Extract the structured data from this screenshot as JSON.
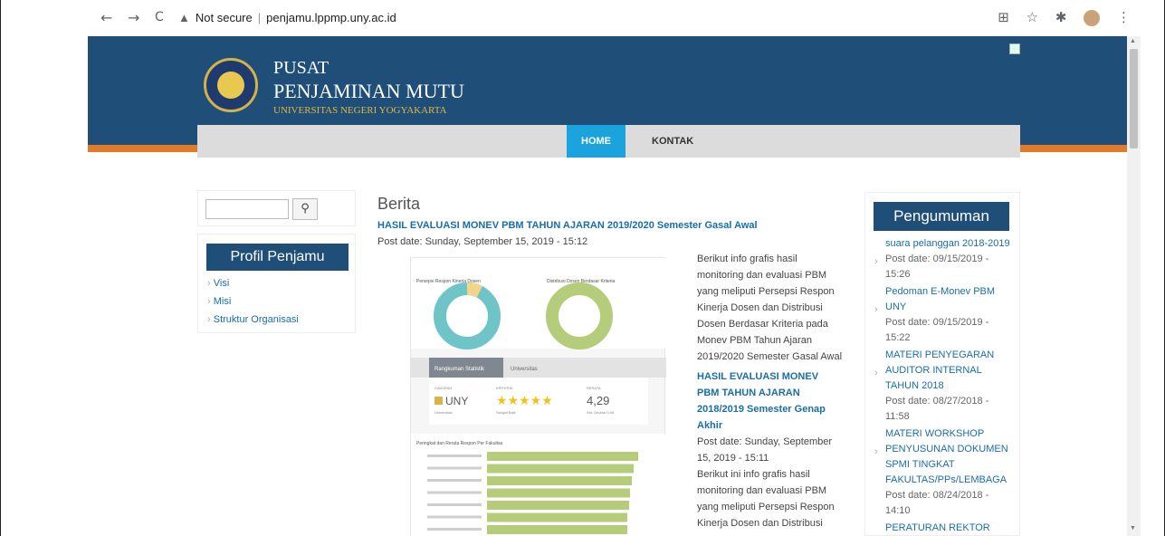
{
  "browser": {
    "back": "←",
    "forward": "→",
    "reload": "C",
    "security_label": "Not secure",
    "url": "penjamu.lppmp.uny.ac.id"
  },
  "site": {
    "title_line1": "PUSAT",
    "title_line2": "PENJAMINAN MUTU",
    "subtitle": "UNIVERSITAS NEGERI YOGYAKARTA",
    "menu": [
      {
        "label": "HOME"
      },
      {
        "label": "KONTAK"
      }
    ]
  },
  "sidebar": {
    "search_placeholder": "",
    "search_icon": "search-icon",
    "profil_title": "Profil Penjamu",
    "items": [
      {
        "label": "Visi"
      },
      {
        "label": "Misi"
      },
      {
        "label": "Struktur Organisasi"
      }
    ]
  },
  "main": {
    "section_title": "Berita",
    "post1_title": "HASIL EVALUASI MONEV PBM TAHUN AJARAN 2019/2020 Semester Gasal Awal",
    "post1_date": "Post date: Sunday, September 15, 2019 - 15:12",
    "post1_body": "Berikut info grafis hasil monitoring dan evaluasi PBM yang meliputi Persepsi Respon Kinerja Dosen dan Distribusi Dosen Berdasar Kriteria pada Monev PBM Tahun Ajaran 2019/2020 Semester Gasal Awal",
    "post2_title": "HASIL EVALUASI MONEV PBM TAHUN AJARAN 2018/2019 Semester Genap Akhir",
    "post2_date": "Post date: Sunday, September 15, 2019 - 15:11",
    "post2_body": "Berikut ini info grafis hasil monitoring dan evaluasi PBM yang meliputi Persepsi Respon Kinerja Dosen dan Distribusi",
    "dashboard": {
      "donut1_title": "Persepsi Respon Kinerja Dosen",
      "donut2_title": "Distribusi Dosen Berdasar Kriteria",
      "tab1": "Rangkuman Statistik",
      "tab2": "Universitas",
      "cakupan_label": "CAKUPAN",
      "kriteria_label": "KRITERIA",
      "rerata_label": "RERATA",
      "cakupan_value": "UNY",
      "cakupan_sub": "Universitas",
      "kriteria_sub": "Sangat Baik",
      "rerata_value": "4,29",
      "rerata_sub": "Std. Deviasi 0,55",
      "stars": 5,
      "bar_title": "Peringkat dan Rerata Respon Per Fakultas",
      "bars": [
        0.95,
        0.92,
        0.91,
        0.9,
        0.89,
        0.88,
        0.88
      ]
    }
  },
  "pengumuman": {
    "title": "Pengumuman",
    "items": [
      {
        "link": "suara pelanggan 2018-2019",
        "date": "Post date: 09/15/2019 - 15:26"
      },
      {
        "link": "Pedoman E-Monev PBM UNY",
        "date": "Post date: 09/15/2019 - 15:22"
      },
      {
        "link": "MATERI PENYEGARAN AUDITOR INTERNAL TAHUN 2018",
        "date": "Post date: 08/27/2018 - 11:58"
      },
      {
        "link": "MATERI WORKSHOP PENYUSUNAN DOKUMEN SPMI TINGKAT FAKULTAS/PPs/LEMBAGA",
        "date": "Post date: 08/24/2018 - 14:10"
      },
      {
        "link": "PERATURAN REKTOR",
        "date": ""
      }
    ]
  },
  "colors": {
    "header": "#1f4e79",
    "accent_orange": "#e07b2a",
    "menu_active": "#1aa3dd",
    "link": "#1a6ea8"
  }
}
